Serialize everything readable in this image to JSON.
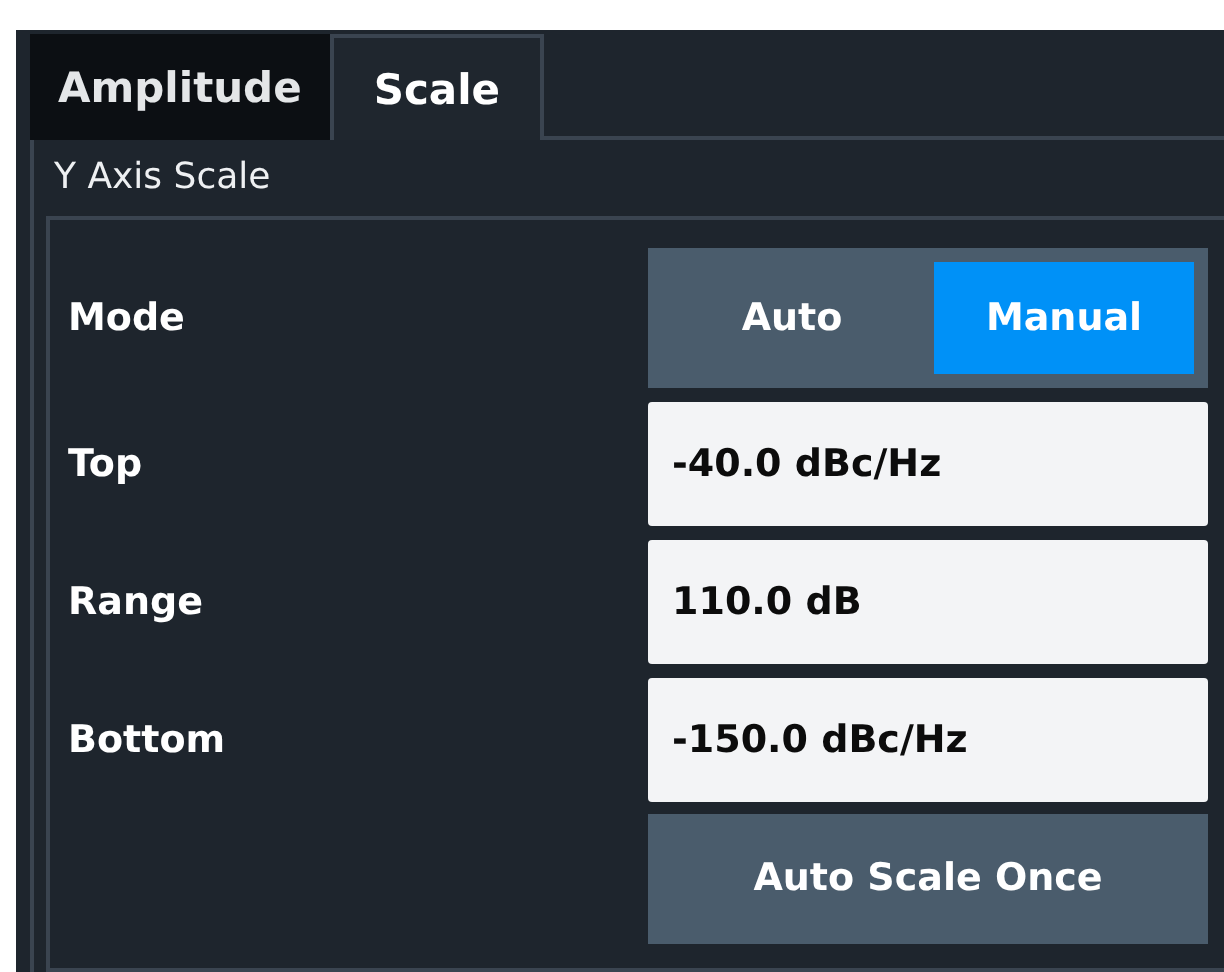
{
  "tabs": [
    {
      "label": "Amplitude",
      "selected": false
    },
    {
      "label": "Scale",
      "selected": true
    }
  ],
  "group": {
    "title": "Y Axis Scale",
    "rows": [
      {
        "kind": "toggle",
        "label": "Mode",
        "options": [
          {
            "label": "Auto",
            "selected": false
          },
          {
            "label": "Manual",
            "selected": true
          }
        ]
      },
      {
        "kind": "field",
        "label": "Top",
        "value": "-40.0 dBc/Hz"
      },
      {
        "kind": "field",
        "label": "Range",
        "value": "110.0 dB"
      },
      {
        "kind": "field",
        "label": "Bottom",
        "value": "-150.0 dBc/Hz"
      },
      {
        "kind": "button",
        "label": "Auto Scale Once"
      }
    ]
  }
}
